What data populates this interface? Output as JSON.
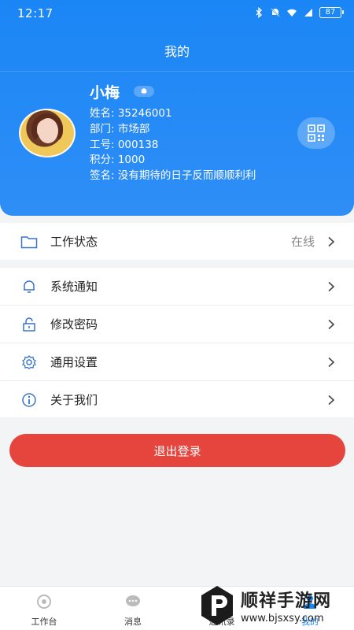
{
  "status_bar": {
    "time": "12:17",
    "battery": "87"
  },
  "nav": {
    "title": "我的"
  },
  "profile": {
    "name": "小梅",
    "lines": [
      "姓名: 35246001",
      "部门: 市场部",
      "工号: 000138",
      "积分: 1000",
      "签名: 没有期待的日子反而顺顺利利"
    ]
  },
  "status_row": {
    "label": "工作状态",
    "value": "在线"
  },
  "menu": [
    {
      "label": "系统通知",
      "icon": "bell-icon"
    },
    {
      "label": "修改密码",
      "icon": "lock-icon"
    },
    {
      "label": "通用设置",
      "icon": "gear-icon"
    },
    {
      "label": "关于我们",
      "icon": "info-icon"
    }
  ],
  "logout": {
    "label": "退出登录"
  },
  "tabs": [
    {
      "label": "工作台",
      "icon": "workbench-icon"
    },
    {
      "label": "消息",
      "icon": "message-icon"
    },
    {
      "label": "通讯录",
      "icon": "contacts-icon"
    },
    {
      "label": "我的",
      "icon": "profile-icon"
    }
  ],
  "watermark": {
    "title": "顺祥手游网",
    "url": "www.bjsxsy.com"
  },
  "colors": {
    "primary": "#1a86f5",
    "logout": "#e5453d",
    "background": "#f3f4f6"
  }
}
